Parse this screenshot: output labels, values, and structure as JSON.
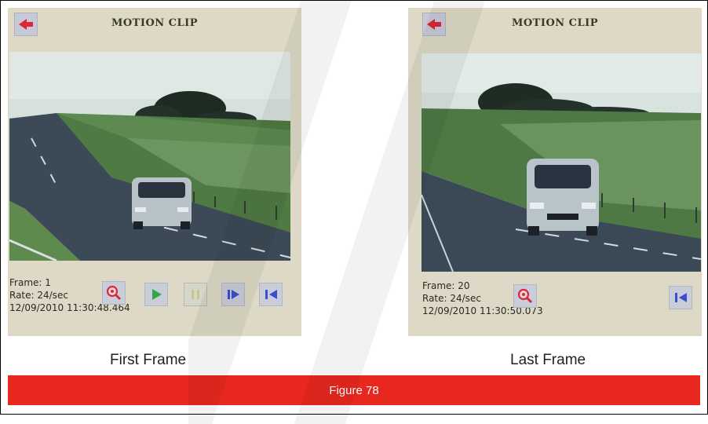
{
  "panels": [
    {
      "title": "MOTION CLIP",
      "frame": "Frame: 1",
      "rate": "Rate: 24/sec",
      "timestamp": "12/09/2010 11:30:48.464",
      "caption": "First Frame"
    },
    {
      "title": "MOTION CLIP",
      "frame": "Frame: 20",
      "rate": "Rate: 24/sec",
      "timestamp": "12/09/2010 11:30:50.073",
      "caption": "Last Frame"
    }
  ],
  "figure_label": "Figure 78",
  "icons": {
    "back": "back-arrow-icon",
    "zoom": "zoom-icon",
    "play": "play-icon",
    "pause": "pause-icon",
    "step_forward": "step-forward-icon",
    "skip_to_start": "skip-to-start-icon"
  },
  "colors": {
    "panel_bg": "#ddd9c6",
    "figure_bar": "#e8271f",
    "arrow_red": "#d8283a",
    "control_blue": "#3a4fd0",
    "play_green": "#33a84a"
  }
}
